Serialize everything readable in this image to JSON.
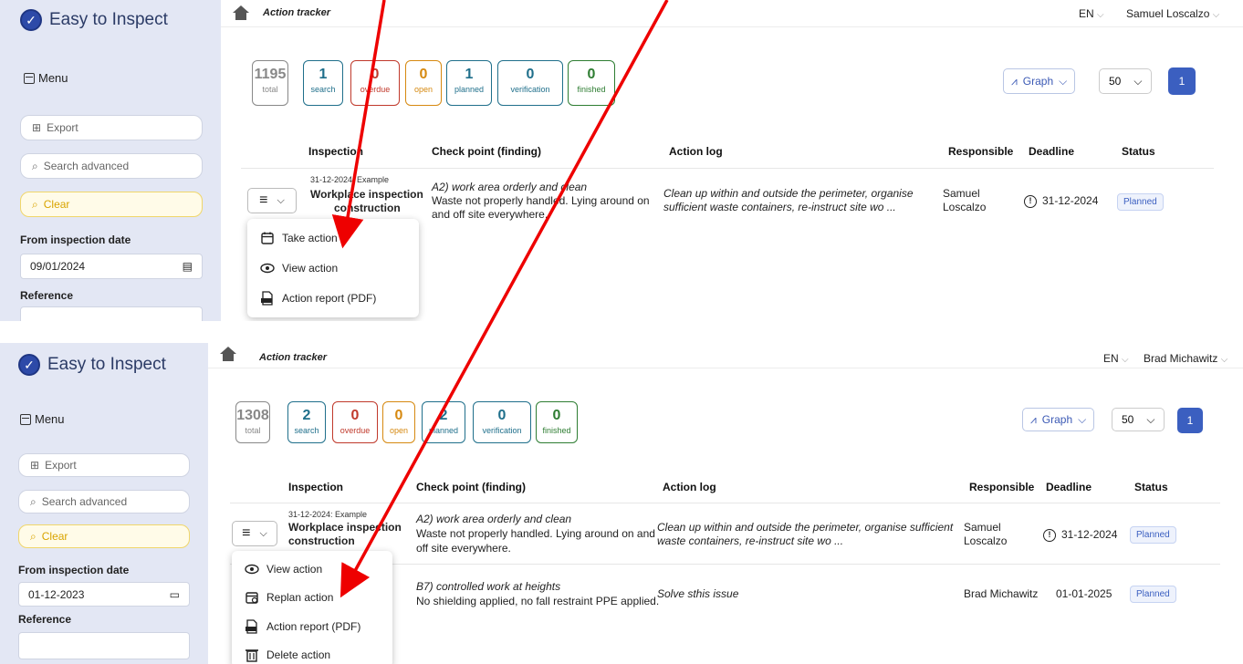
{
  "panels": [
    {
      "app_name": "Easy to Inspect",
      "menu_label": "Menu",
      "export_label": "Export",
      "search_placeholder": "Search advanced",
      "clear_label": "Clear",
      "from_date_label": "From inspection date",
      "from_date_value": "09/01/2024",
      "reference_label": "Reference",
      "breadcrumb": "Action tracker",
      "language": "EN",
      "user": "Samuel Loscalzo",
      "stats": [
        {
          "value": "1195",
          "label": "total",
          "color": "#888888"
        },
        {
          "value": "1",
          "label": "search",
          "color": "#1f6f8b"
        },
        {
          "value": "0",
          "label": "overdue",
          "color": "#c0392b"
        },
        {
          "value": "0",
          "label": "open",
          "color": "#d68910"
        },
        {
          "value": "1",
          "label": "planned",
          "color": "#1f6f8b"
        },
        {
          "value": "0",
          "label": "verification",
          "color": "#1f6f8b"
        },
        {
          "value": "0",
          "label": "finished",
          "color": "#2e7d32"
        }
      ],
      "graph_label": "Graph",
      "page_size": "50",
      "page": "1",
      "headers": {
        "inspection": "Inspection",
        "checkpoint": "Check point (finding)",
        "log": "Action log",
        "responsible": "Responsible",
        "deadline": "Deadline",
        "status": "Status"
      },
      "rows": [
        {
          "date_line": "31-12-2024: Example",
          "title1": "Workplace inspection",
          "title2": "construction",
          "finding_title": "A2) work area orderly and clean",
          "finding_l1": "Waste not properly handled. Lying around on",
          "finding_l2": "and off site everywhere.",
          "log_l1": "Clean up within and outside the perimeter, organise",
          "log_l2": "sufficient waste containers, re-instruct site wo ...",
          "resp_l1": "Samuel",
          "resp_l2": "Loscalzo",
          "deadline": "31-12-2024",
          "status": "Planned"
        }
      ],
      "menu_items": [
        "Take action",
        "View action",
        "Action report (PDF)"
      ]
    },
    {
      "app_name": "Easy to Inspect",
      "menu_label": "Menu",
      "export_label": "Export",
      "search_placeholder": "Search advanced",
      "clear_label": "Clear",
      "from_date_label": "From inspection date",
      "from_date_value": "01-12-2023",
      "reference_label": "Reference",
      "breadcrumb": "Action tracker",
      "language": "EN",
      "user": "Brad Michawitz",
      "stats": [
        {
          "value": "1308",
          "label": "total",
          "color": "#888888"
        },
        {
          "value": "2",
          "label": "search",
          "color": "#1f6f8b"
        },
        {
          "value": "0",
          "label": "overdue",
          "color": "#c0392b"
        },
        {
          "value": "0",
          "label": "open",
          "color": "#d68910"
        },
        {
          "value": "2",
          "label": "planned",
          "color": "#1f6f8b"
        },
        {
          "value": "0",
          "label": "verification",
          "color": "#1f6f8b"
        },
        {
          "value": "0",
          "label": "finished",
          "color": "#2e7d32"
        }
      ],
      "graph_label": "Graph",
      "page_size": "50",
      "page": "1",
      "headers": {
        "inspection": "Inspection",
        "checkpoint": "Check point (finding)",
        "log": "Action log",
        "responsible": "Responsible",
        "deadline": "Deadline",
        "status": "Status"
      },
      "rows": [
        {
          "date_line": "31-12-2024: Example",
          "title1": "Workplace inspection",
          "title2": "construction",
          "finding_title": "A2) work area orderly and clean",
          "finding_l1": "Waste not properly handled. Lying around on and",
          "finding_l2": "off site everywhere.",
          "log_l1": "Clean up within and outside the perimeter, organise sufficient",
          "log_l2": "waste containers, re-instruct site wo ...",
          "resp_l1": "Samuel",
          "resp_l2": "Loscalzo",
          "deadline": "31-12-2024",
          "status": "Planned"
        },
        {
          "finding_title": "B7) controlled work at heights",
          "finding_l1": "No shielding applied, no fall restraint PPE applied.",
          "log_l1": "Solve sthis issue",
          "responsible": "Brad Michawitz",
          "deadline": "01-01-2025",
          "status": "Planned"
        }
      ],
      "menu_items": [
        "View action",
        "Replan action",
        "Action report (PDF)",
        "Delete action"
      ]
    }
  ],
  "colors": {
    "accent": "#3b5fc0",
    "sidebar": "#e3e7f4",
    "arrow": "#ee0000"
  }
}
